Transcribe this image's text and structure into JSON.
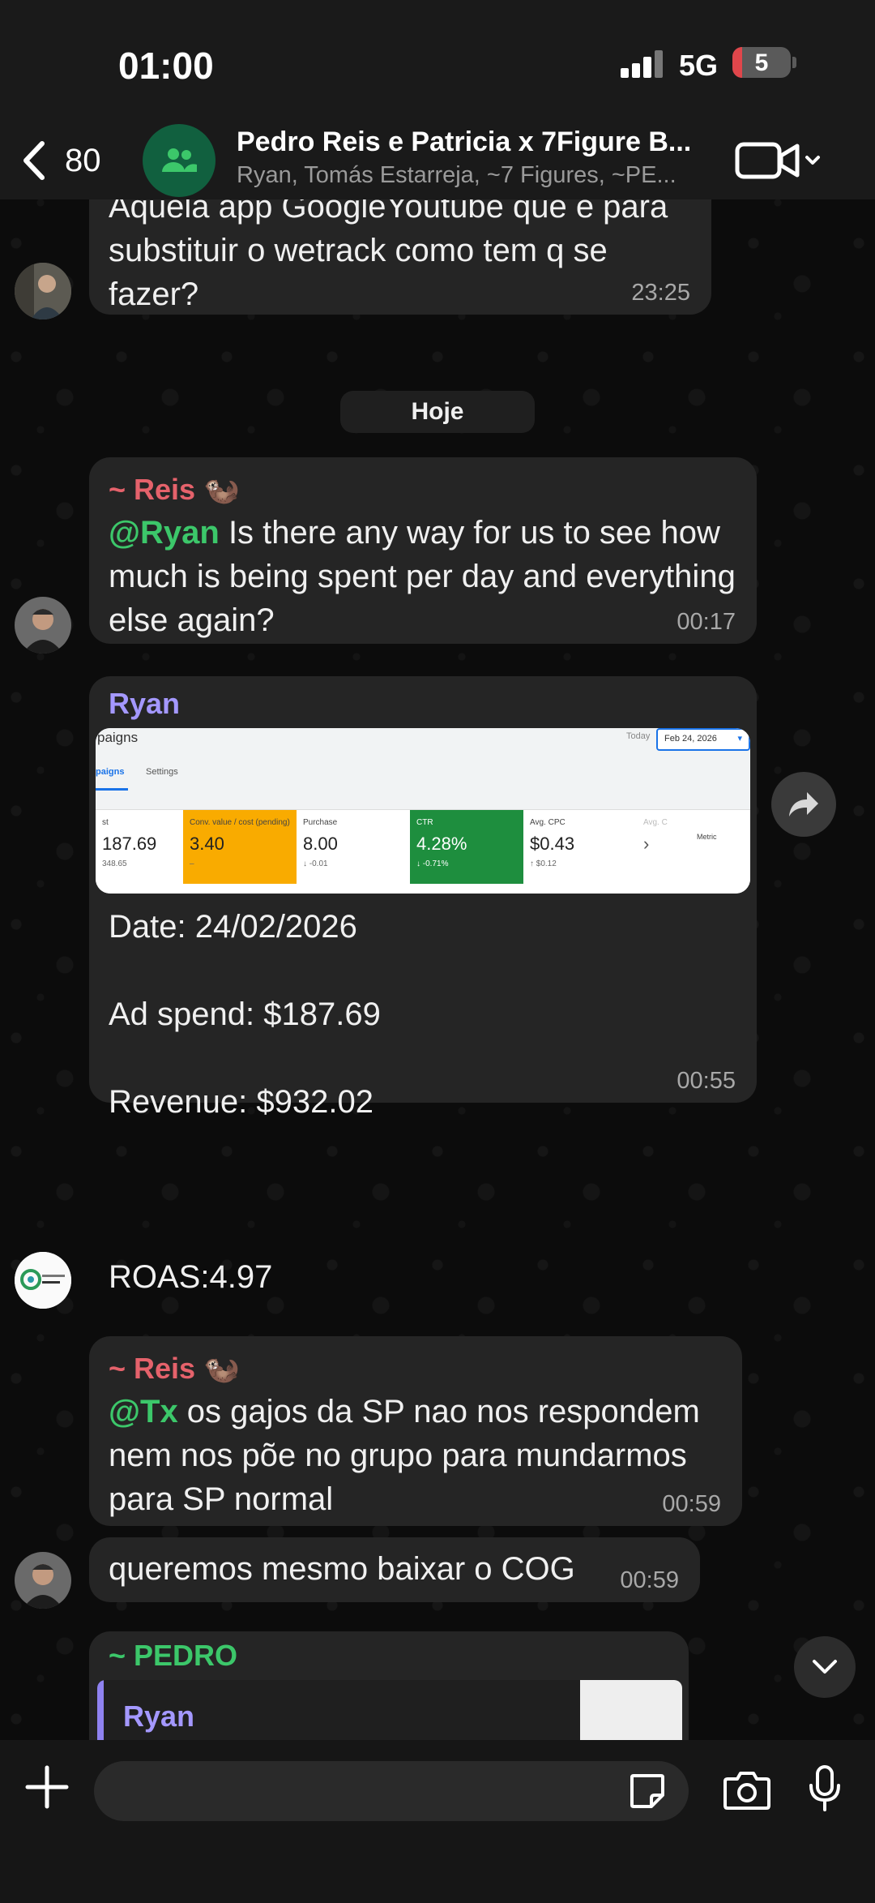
{
  "status": {
    "time": "01:00",
    "network": "5G",
    "battery": "5"
  },
  "header": {
    "back_count": "80",
    "title": "Pedro Reis e Patricia x 7Figure B...",
    "subtitle": "Ryan, Tomás Estarreja, ~7 Figures, ~PE..."
  },
  "messages": {
    "m1": {
      "text": "Aquela app GoogleYoutube que é para substituir o wetrack como tem q se fazer?",
      "time": "23:25"
    },
    "date_divider": "Hoje",
    "m2": {
      "sender": "~ Reis",
      "sender_emoji": "🦦",
      "mention": "@Ryan",
      "text": " Is there any way for us to see how much is being spent per day and everything else again?",
      "time": "00:17"
    },
    "m3": {
      "sender": "Ryan",
      "screenshot": {
        "title": "paigns",
        "today": "Today",
        "date": "Feb 24, 2026",
        "tab1": "paigns",
        "tab2": "Settings",
        "metrics": [
          {
            "label": "st",
            "value": "187.69",
            "delta": "348.65",
            "style": "plain"
          },
          {
            "label": "Conv. value / cost (pending)",
            "value": "3.40",
            "delta": "–",
            "style": "orange"
          },
          {
            "label": "Purchase",
            "value": "8.00",
            "delta": "↓ -0.01",
            "style": "plain"
          },
          {
            "label": "CTR",
            "value": "4.28%",
            "delta": "↓ -0.71%",
            "style": "green"
          },
          {
            "label": "Avg. CPC",
            "value": "$0.43",
            "delta": "↑ $0.12",
            "style": "plain"
          },
          {
            "label": "Avg. C",
            "value": "›",
            "delta": "",
            "style": "plain"
          }
        ],
        "metrics_label": "Metric"
      },
      "line1": "Date: 24/02/2026",
      "line2": "Ad spend: $187.69",
      "line3": "Revenue: $932.02",
      "line4": "ROAS:4.97",
      "time": "00:55"
    },
    "m4": {
      "sender": "~ Reis",
      "sender_emoji": "🦦",
      "mention": "@Tx",
      "text": " os gajos da SP nao nos respondem nem nos põe no grupo para mundarmos para SP normal",
      "time": "00:59"
    },
    "m5": {
      "text": "queremos mesmo baixar o COG",
      "time": "00:59"
    },
    "m6": {
      "sender": "~ PEDRO",
      "reply_name": "Ryan"
    }
  },
  "colors": {
    "reis": "#e5626b",
    "ryan": "#a498ff",
    "pedro": "#3cc76a",
    "mention_green": "#3cc76a"
  },
  "icons": [
    "chevron-left-icon",
    "group-icon",
    "video-camera-icon",
    "forward-icon",
    "chevron-down-icon",
    "plus-icon",
    "sticker-icon",
    "camera-icon",
    "microphone-icon"
  ]
}
